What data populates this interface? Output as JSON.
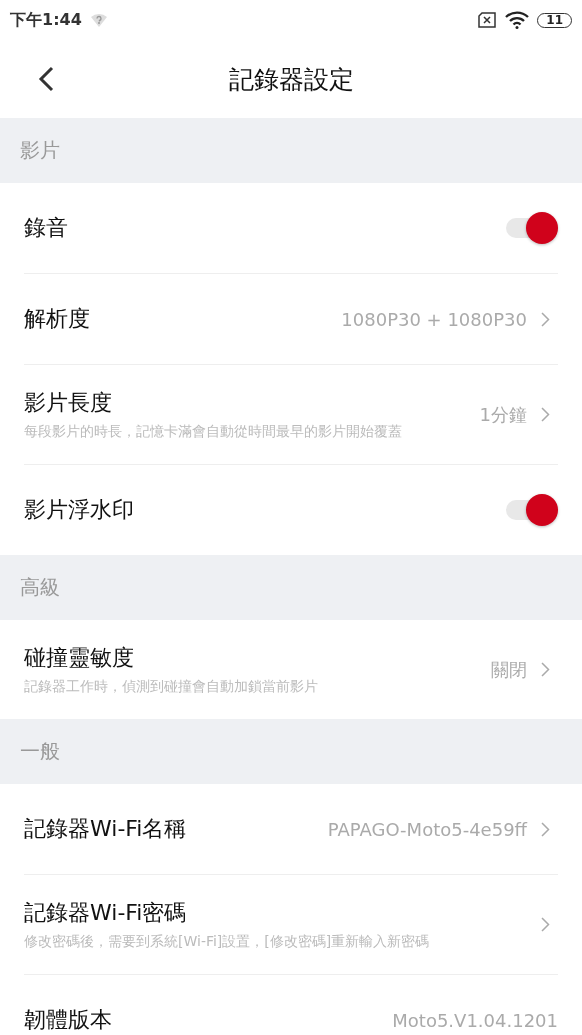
{
  "status_bar": {
    "time": "下午1:44",
    "battery": "11"
  },
  "header": {
    "title": "記錄器設定"
  },
  "sections": [
    {
      "title": "影片",
      "rows": [
        {
          "kind": "toggle",
          "title": "錄音",
          "on": true
        },
        {
          "kind": "value",
          "title": "解析度",
          "value": "1080P30 + 1080P30"
        },
        {
          "kind": "value",
          "title": "影片長度",
          "description": "每段影片的時長，記憶卡滿會自動從時間最早的影片開始覆蓋",
          "value": "1分鐘"
        },
        {
          "kind": "toggle",
          "title": "影片浮水印",
          "on": true
        }
      ]
    },
    {
      "title": "高級",
      "rows": [
        {
          "kind": "value",
          "title": "碰撞靈敏度",
          "description": "記錄器工作時，偵測到碰撞會自動加鎖當前影片",
          "value": "關閉"
        }
      ]
    },
    {
      "title": "一般",
      "rows": [
        {
          "kind": "value",
          "title": "記錄器Wi-Fi名稱",
          "value": "PAPAGO-Moto5-4e59ff"
        },
        {
          "kind": "value",
          "title": "記錄器Wi-Fi密碼",
          "description": "修改密碼後，需要到系統[Wi-Fi]設置，[修改密碼]重新輸入新密碼"
        },
        {
          "kind": "info",
          "title": "韌體版本",
          "value": "Moto5.V1.04.1201"
        }
      ]
    }
  ]
}
